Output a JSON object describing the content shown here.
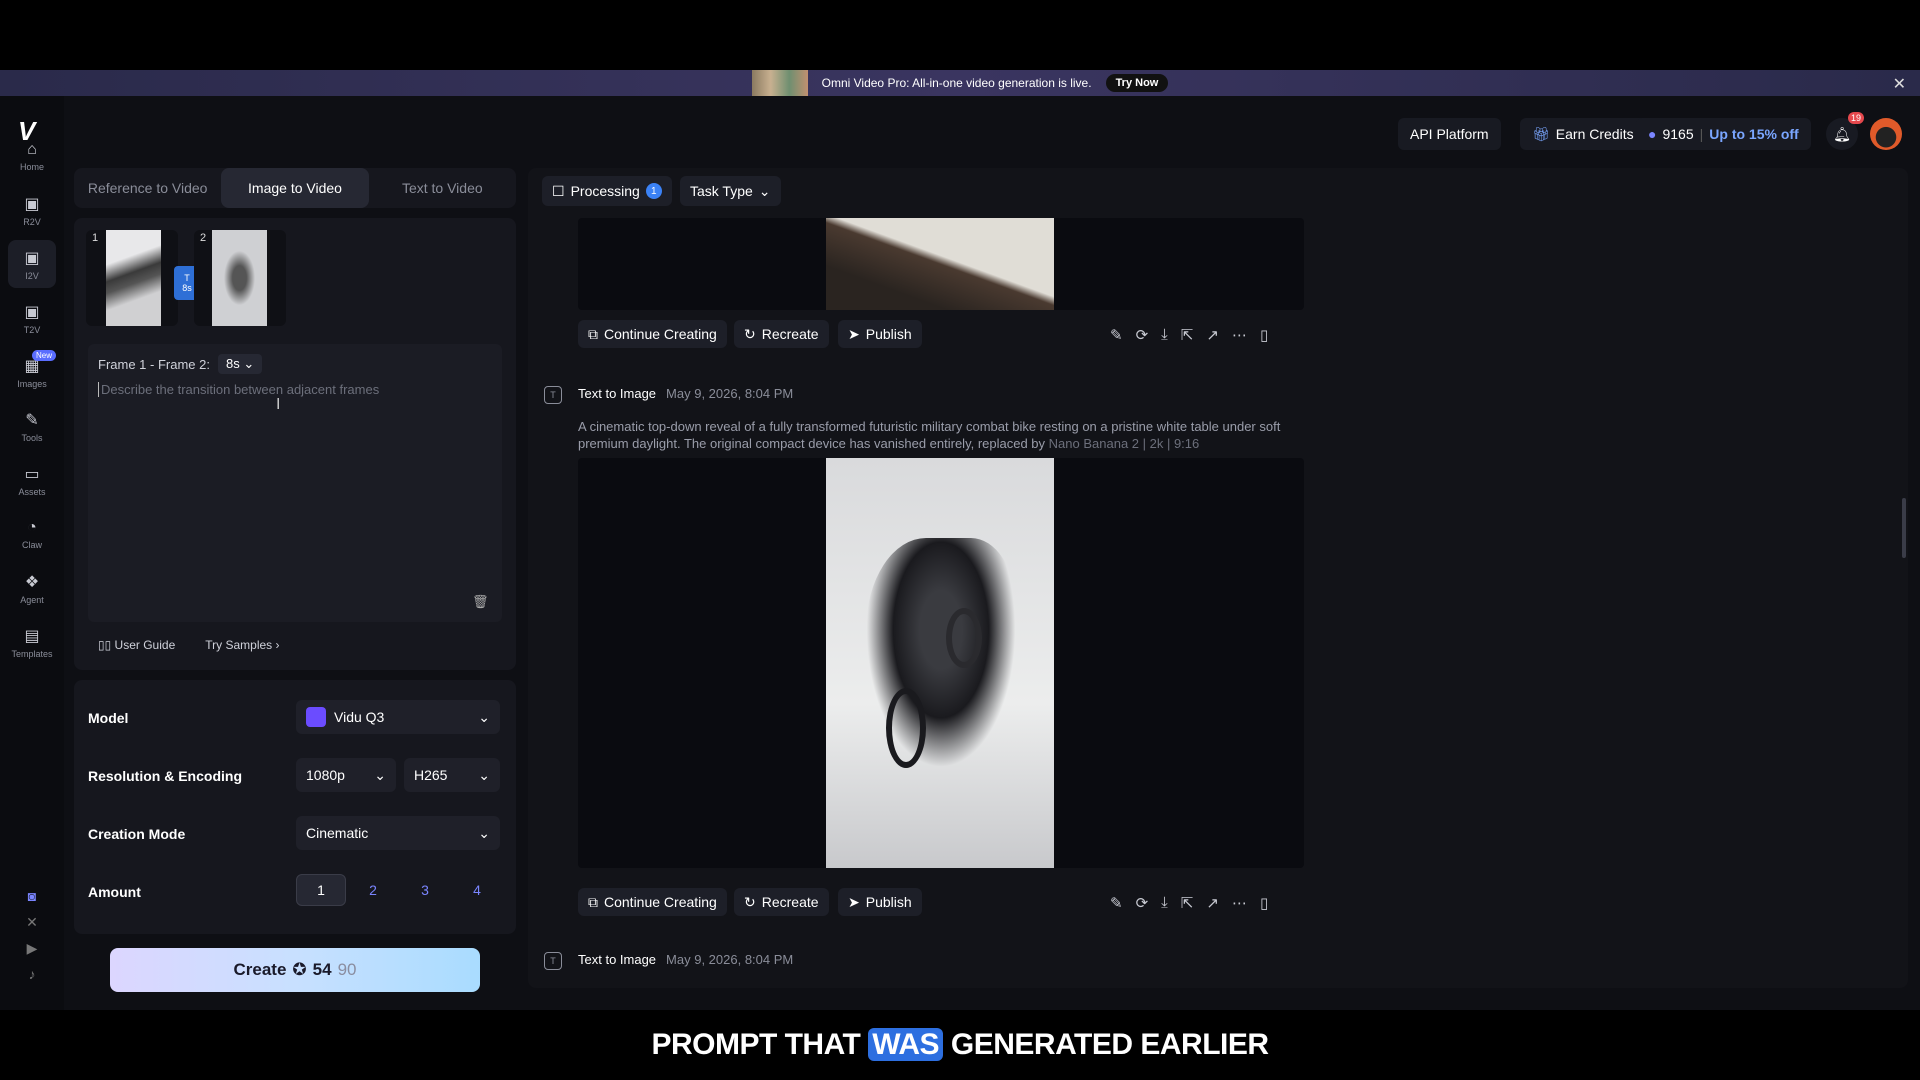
{
  "banner": {
    "text": "Omni Video Pro: All-in-one video generation is live.",
    "button": "Try Now"
  },
  "rail": {
    "items": [
      {
        "label": "Home",
        "icon": "home-icon",
        "glyph": "⌂"
      },
      {
        "label": "R2V",
        "icon": "r2v-icon",
        "glyph": "▣"
      },
      {
        "label": "I2V",
        "icon": "i2v-icon",
        "glyph": "▣"
      },
      {
        "label": "T2V",
        "icon": "t2v-icon",
        "glyph": "▣"
      },
      {
        "label": "Images",
        "icon": "images-icon",
        "glyph": "▦"
      },
      {
        "label": "Tools",
        "icon": "tools-icon",
        "glyph": "✎"
      },
      {
        "label": "Assets",
        "icon": "assets-icon",
        "glyph": "▭"
      },
      {
        "label": "Claw",
        "icon": "claw-icon",
        "glyph": "◔"
      },
      {
        "label": "Agent",
        "icon": "agent-icon",
        "glyph": "❖"
      },
      {
        "label": "Templates",
        "icon": "templates-icon",
        "glyph": "▤"
      }
    ],
    "new_badge": "New"
  },
  "header": {
    "api_platform": "API Platform",
    "earn_credits": "Earn Credits",
    "credits": "9165",
    "discount": "Up to 15% off",
    "notifications": "19"
  },
  "tabs": [
    "Reference to Video",
    "Image to Video",
    "Text to Video"
  ],
  "frames": {
    "frame1_num": "1",
    "frame2_num": "2",
    "transition_label": "T",
    "transition_duration": "8s",
    "pair_label": "Frame 1 - Frame 2:",
    "duration": "8s",
    "placeholder": "Describe the transition between adjacent frames"
  },
  "guide": {
    "user_guide": "User Guide",
    "try_samples": "Try Samples"
  },
  "settings": {
    "model_label": "Model",
    "model_value": "Vidu Q3",
    "resolution_label": "Resolution & Encoding",
    "resolution_value": "1080p",
    "encoding_value": "H265",
    "mode_label": "Creation Mode",
    "mode_value": "Cinematic",
    "amount_label": "Amount",
    "amounts": [
      "1",
      "2",
      "3",
      "4"
    ]
  },
  "create": {
    "label": "Create",
    "cost": "54",
    "cost_original": "90"
  },
  "feed": {
    "processing": "Processing",
    "processing_count": "1",
    "task_type": "Task Type",
    "actions": {
      "continue": "Continue Creating",
      "recreate": "Recreate",
      "publish": "Publish"
    },
    "task1": {
      "type": "Text to Image",
      "date": "May 9, 2026, 8:04 PM",
      "prompt": "A cinematic top-down reveal of a fully transformed futuristic military combat bike resting on a pristine white table under soft premium daylight. The original compact device has vanished entirely, replaced by",
      "meta": "Nano Banana 2 | 2k | 9:16"
    },
    "task2": {
      "type": "Text to Image",
      "date": "May 9, 2026, 8:04 PM"
    }
  },
  "caption": {
    "before": "PROMPT THAT",
    "highlight": "WAS",
    "after": "GENERATED EARLIER"
  }
}
